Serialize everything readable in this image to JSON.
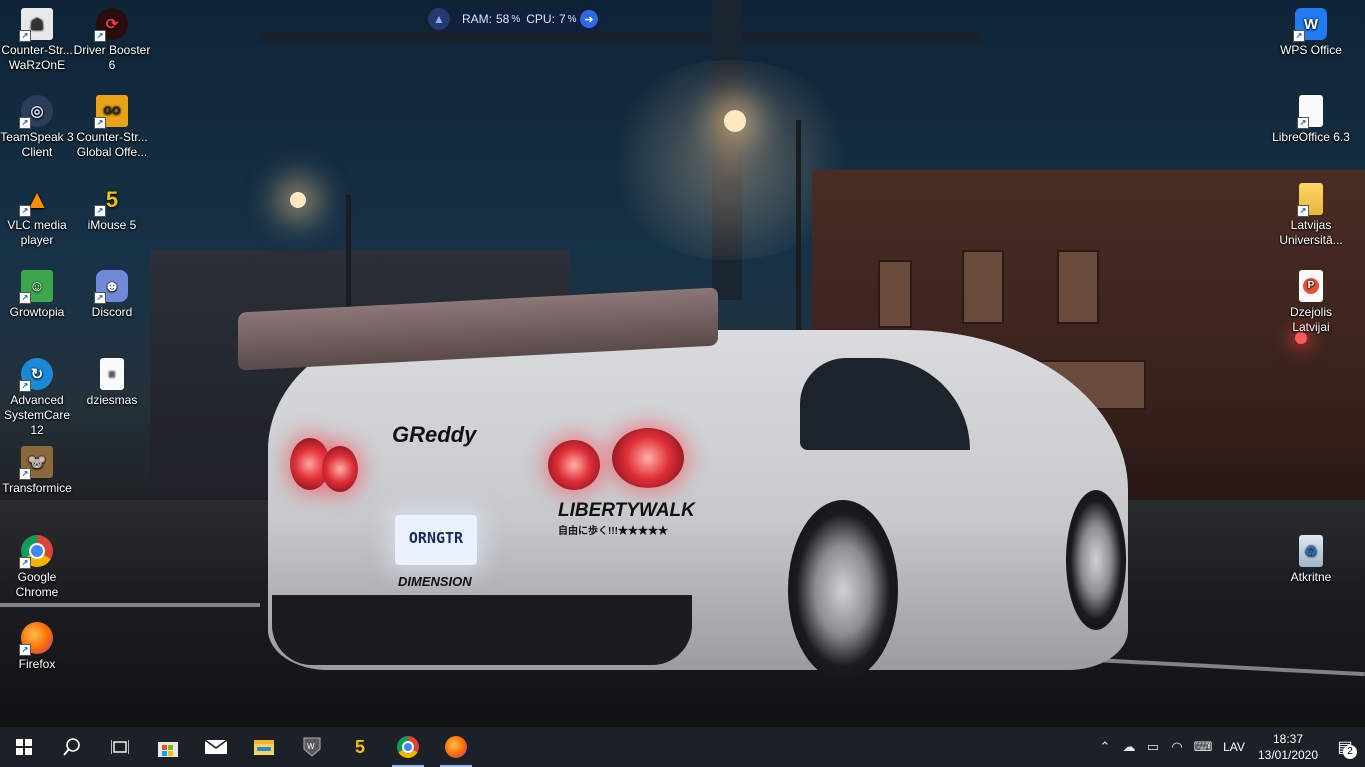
{
  "widget": {
    "ram_label": "RAM:",
    "ram_value": "58",
    "cpu_label": "CPU:",
    "cpu_value": "7",
    "unit": "%"
  },
  "desktop": {
    "icons_left": [
      {
        "label": "Counter-Str... WaRzOnE",
        "icon": "counter-strike-icon"
      },
      {
        "label": "TeamSpeak 3 Client",
        "icon": "teamspeak-icon"
      },
      {
        "label": "VLC media player",
        "icon": "vlc-icon"
      },
      {
        "label": "Growtopia",
        "icon": "growtopia-icon"
      },
      {
        "label": "Advanced SystemCare 12",
        "icon": "advanced-systemcare-icon"
      },
      {
        "label": "Transformice",
        "icon": "transformice-icon"
      },
      {
        "label": "Google Chrome",
        "icon": "chrome-icon"
      },
      {
        "label": "Firefox",
        "icon": "firefox-icon"
      }
    ],
    "icons_left2": [
      {
        "label": "Driver Booster 6",
        "icon": "driver-booster-icon"
      },
      {
        "label": "Counter-Str... Global Offe...",
        "icon": "csgo-icon"
      },
      {
        "label": "iMouse 5",
        "icon": "imouse-icon"
      },
      {
        "label": "Discord",
        "icon": "discord-icon"
      },
      {
        "label": "dziesmas",
        "icon": "text-file-icon"
      }
    ],
    "icons_right": [
      {
        "label": "WPS Office",
        "icon": "wps-office-icon"
      },
      {
        "label": "LibreOffice 6.3",
        "icon": "libreoffice-icon"
      },
      {
        "label": "Latvijas Universitā...",
        "icon": "folder-icon"
      },
      {
        "label": "Dzejolis Latvijai",
        "icon": "powerpoint-file-icon"
      },
      {
        "label": "Atkritne",
        "icon": "recycle-bin-icon"
      }
    ]
  },
  "wallpaper": {
    "car_brand_decal": "GReddy",
    "rear_decal": "LIBERTYWALK",
    "rear_decal_sub": "自由に歩く!!!★★★★★",
    "plate": "ORNGTR",
    "bumper_decal": "DIMENSION"
  },
  "taskbar": {
    "apps": [
      "start-icon",
      "search-icon",
      "task-view-icon",
      "store-icon",
      "mail-icon",
      "file-explorer-icon",
      "world-of-tanks-icon",
      "imouse-icon",
      "chrome-icon",
      "firefox-icon"
    ],
    "language": "LAV",
    "time": "18:37",
    "date": "13/01/2020",
    "notification_count": "2"
  },
  "colors": {
    "taskbar_bg": "#1c2027",
    "accent": "#2e6ae0"
  }
}
